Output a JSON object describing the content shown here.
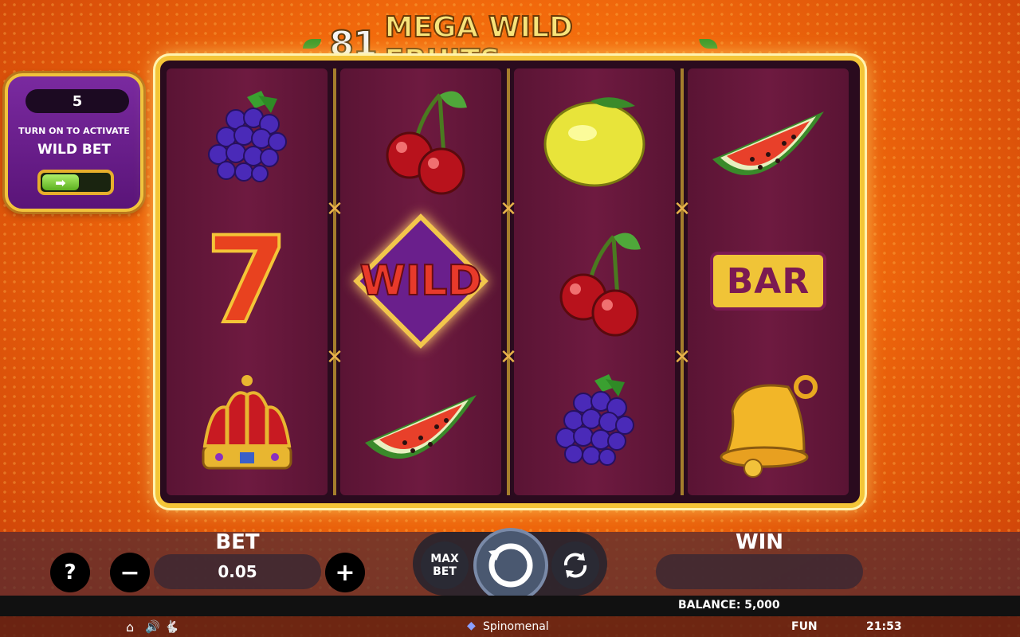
{
  "game": {
    "title_number": "81",
    "title_name": "MEGA WILD FRUITS"
  },
  "wild_bet": {
    "count": "5",
    "hint": "TURN ON TO ACTIVATE",
    "label": "WILD BET",
    "toggle_icon": "arrow-right-icon"
  },
  "reels": [
    [
      "grapes",
      "seven",
      "crown"
    ],
    [
      "cherries",
      "wild",
      "watermelon"
    ],
    [
      "lemon",
      "cherries",
      "grapes"
    ],
    [
      "watermelon",
      "bar",
      "bell"
    ]
  ],
  "symbols": {
    "seven_text": "7",
    "wild_text": "WILD",
    "bar_text": "BAR"
  },
  "controls": {
    "help_label": "?",
    "minus_label": "−",
    "plus_label": "+",
    "bet_title": "BET",
    "bet_value": "0.05",
    "max_bet_line1": "MAX",
    "max_bet_line2": "BET",
    "win_title": "WIN",
    "win_value": ""
  },
  "info": {
    "balance": "BALANCE: 5,000"
  },
  "footer": {
    "brand": "Spinomenal",
    "mode": "FUN",
    "time": "21:53"
  }
}
